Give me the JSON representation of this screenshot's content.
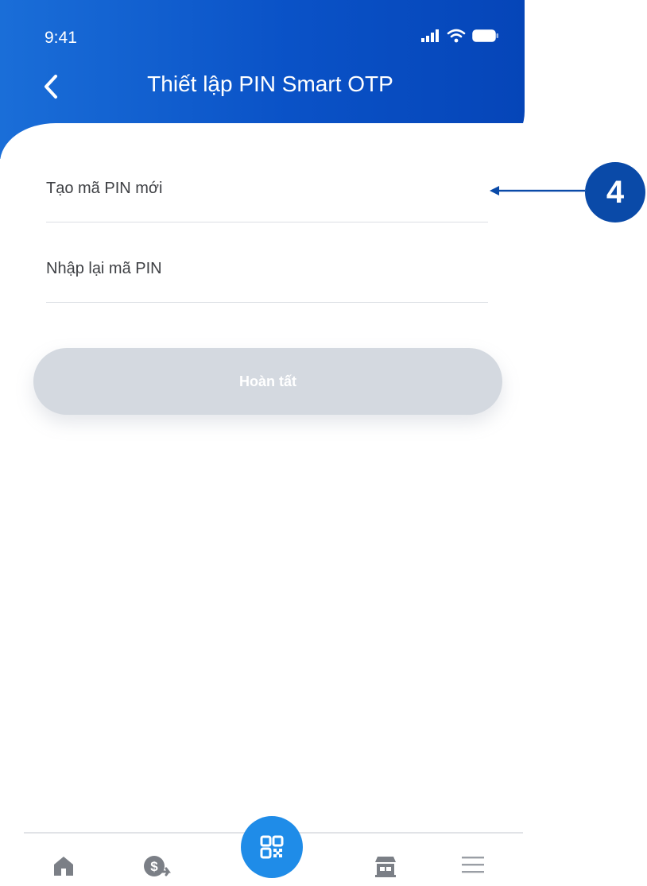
{
  "status_bar": {
    "time": "9:41"
  },
  "header": {
    "title": "Thiết lập PIN Smart OTP"
  },
  "form": {
    "new_pin_label": "Tạo mã PIN mới",
    "confirm_pin_label": "Nhập lại mã PIN",
    "submit_label": "Hoàn tất"
  },
  "tabbar": {
    "items": [
      "home-icon",
      "money-transfer-icon",
      "qr-code-icon",
      "store-icon",
      "menu-icon"
    ]
  },
  "annotation": {
    "step": "4"
  },
  "colors": {
    "header_blue": "#0a52c7",
    "button_disabled": "#d4d9e0",
    "qr_blue": "#1f8ce8",
    "annotation_blue": "#0a4aa8"
  }
}
